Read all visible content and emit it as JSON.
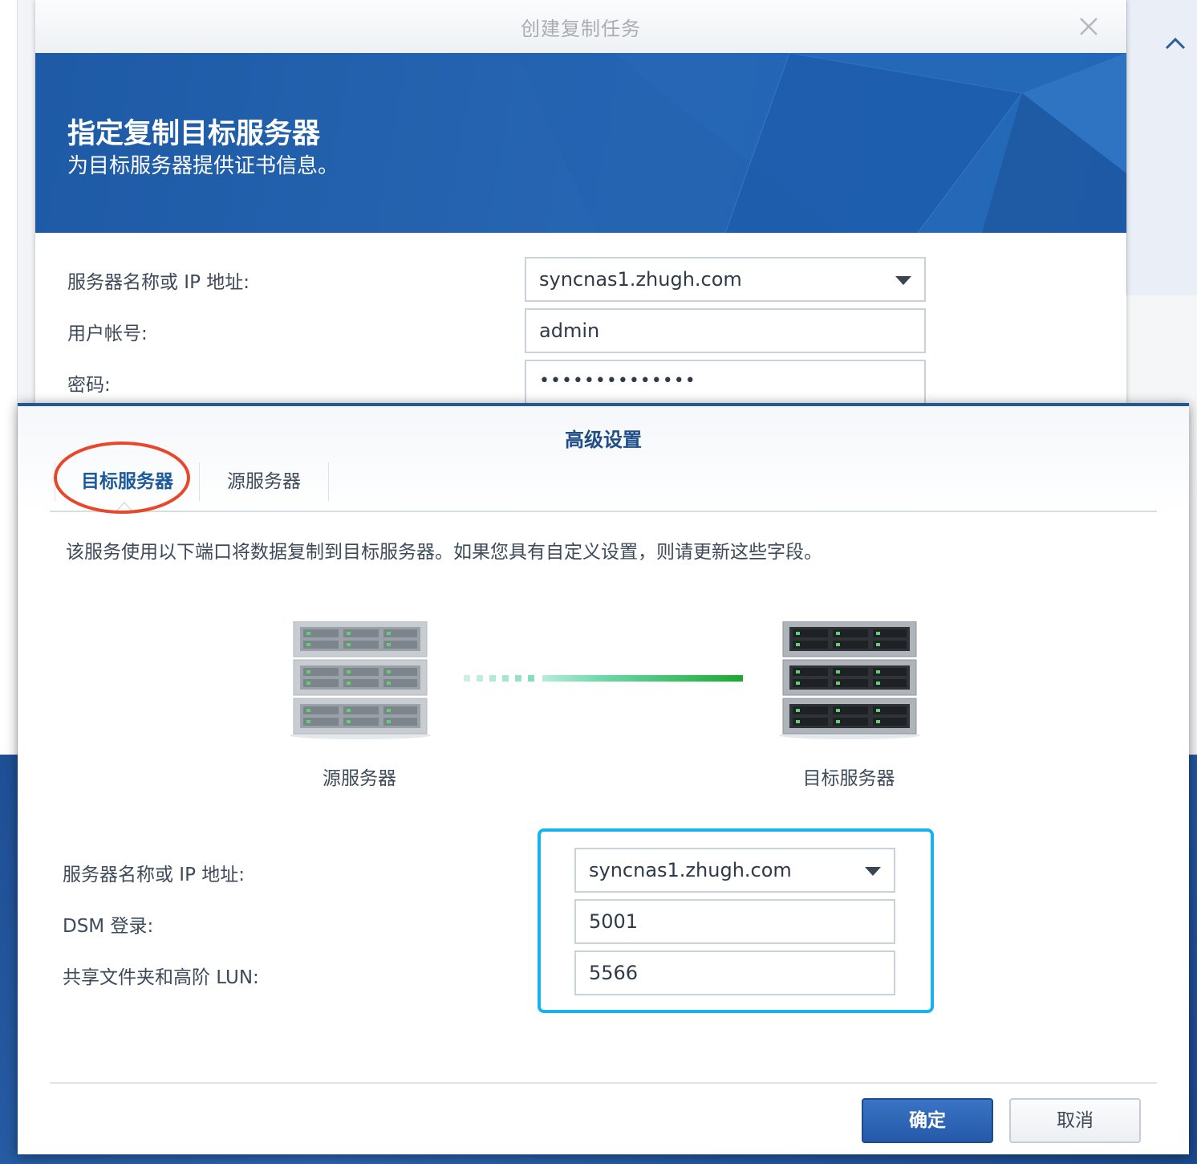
{
  "back_window": {
    "title": "创建复制任务",
    "banner_title": "指定复制目标服务器",
    "banner_subtitle": "为目标服务器提供证书信息。",
    "fields": [
      {
        "label": "服务器名称或 IP 地址:",
        "value": "syncnas1.zhugh.com",
        "type": "dropdown"
      },
      {
        "label": "用户帐号:",
        "value": "admin",
        "type": "text"
      },
      {
        "label": "密码:",
        "value": "••••••••••••••",
        "type": "password"
      }
    ]
  },
  "dialog": {
    "title": "高级设置",
    "tabs": [
      {
        "label": "目标服务器",
        "active": true
      },
      {
        "label": "源服务器",
        "active": false
      }
    ],
    "description": "该服务使用以下端口将数据复制到目标服务器。如果您具有自定义设置，则请更新这些字段。",
    "diagram": {
      "source_label": "源服务器",
      "target_label": "目标服务器"
    },
    "fields": [
      {
        "label": "服务器名称或 IP 地址:",
        "value": "syncnas1.zhugh.com",
        "type": "dropdown"
      },
      {
        "label": "DSM 登录:",
        "value": "5001",
        "type": "text"
      },
      {
        "label": "共享文件夹和高阶 LUN:",
        "value": "5566",
        "type": "text"
      }
    ],
    "buttons": {
      "ok": "确定",
      "cancel": "取消"
    }
  },
  "colors": {
    "accent": "#2459a8",
    "banner": "#1e5aa6",
    "highlight_box": "#16b4ee",
    "annotation_circle": "#e8472b",
    "link_green": "#22b34a"
  },
  "icons": [
    "close-icon",
    "chevron-up-icon",
    "dropdown-arrow-icon",
    "server-icon"
  ]
}
